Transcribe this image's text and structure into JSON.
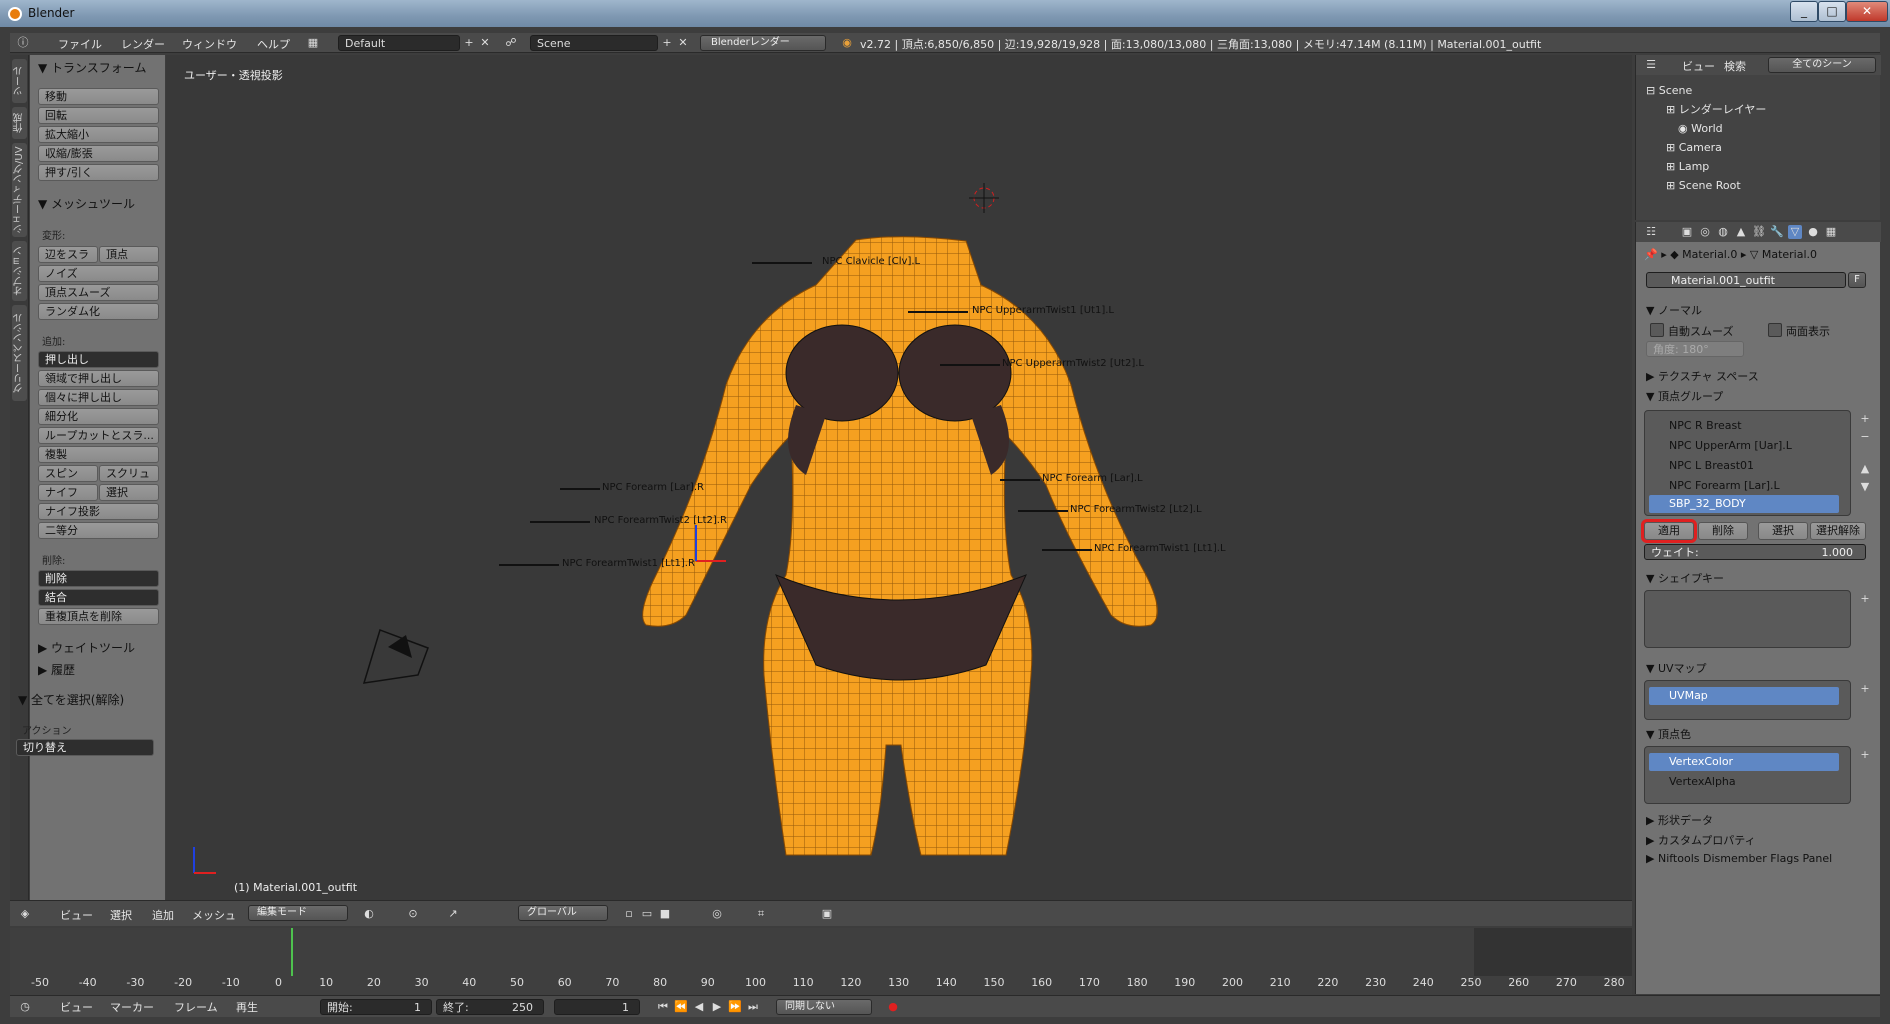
{
  "window": {
    "title": "Blender",
    "buttons": [
      "_",
      "□",
      "✕"
    ]
  },
  "info_header": {
    "menus": [
      "ファイル",
      "レンダー",
      "ウィンドウ",
      "ヘルプ"
    ],
    "screen_layout": "Default",
    "scene": "Scene",
    "render_engine": "Blenderレンダー",
    "stats": "v2.72 | 頂点:6,850/6,850 | 辺:19,928/19,928 | 面:13,080/13,080 | 三角面:13,080 | メモリ:47.14M (8.11M) | Material.001_outfit"
  },
  "left_tabs": [
    "ツール",
    "作成",
    "シェーディング/UV",
    "オプション",
    "グリースペンシル"
  ],
  "tool_panel": {
    "transform_title": "トランスフォーム",
    "transform_buttons": [
      "移動",
      "回転",
      "拡大縮小",
      "収縮/膨張",
      "押す/引く"
    ],
    "mesh_tools_title": "メッシュツール",
    "deform_label": "変形:",
    "deform_row1": [
      "辺をスラ",
      "頂点"
    ],
    "deform_buttons": [
      "ノイズ",
      "頂点スムーズ",
      "ランダム化"
    ],
    "add_label": "追加:",
    "extrude_select": "押し出し",
    "add_buttons": [
      "領域で押し出し",
      "個々に押し出し",
      "細分化",
      "ループカットとスラ...",
      "複製"
    ],
    "spin_row": [
      "スピン",
      "スクリュ"
    ],
    "knife_row": [
      "ナイフ",
      "選択"
    ],
    "add_buttons2": [
      "ナイフ投影",
      "二等分"
    ],
    "remove_label": "削除:",
    "remove_selects": [
      "削除",
      "結合"
    ],
    "remove_doubles": "重複頂点を削除",
    "weight_tools": "ウェイトツール",
    "history": "履歴",
    "select_all_title": "全てを選択(解除)",
    "action_label": "アクション",
    "action_value": "切り替え"
  },
  "viewport": {
    "label": "ユーザー・透視投影",
    "object_label": "(1) Material.001_outfit",
    "bone_labels": [
      "NPC Clavicle [Clv].L",
      "NPC UpperarmTwist1 [Ut1].L",
      "NPC UpperarmTwist2 [Ut2].L",
      "NPC Forearm [Lar].R",
      "NPC ForearmTwist2 [Lt2].R",
      "NPC ForearmTwist1 [Lt1].R",
      "NPC Forearm [Lar].L",
      "NPC ForearmTwist2 [Lt2].L",
      "NPC ForearmTwist1 [Lt1].L"
    ]
  },
  "view_header": {
    "menus": [
      "ビュー",
      "選択",
      "追加",
      "メッシュ"
    ],
    "mode": "編集モード",
    "orientation": "グローバル"
  },
  "timeline": {
    "ticks": [
      "-50",
      "-40",
      "-30",
      "-20",
      "-10",
      "0",
      "10",
      "20",
      "30",
      "40",
      "50",
      "60",
      "70",
      "80",
      "90",
      "100",
      "110",
      "120",
      "130",
      "140",
      "150",
      "160",
      "170",
      "180",
      "190",
      "200",
      "210",
      "220",
      "230",
      "240",
      "250",
      "260",
      "270",
      "280"
    ],
    "menus": [
      "ビュー",
      "マーカー",
      "フレーム",
      "再生"
    ],
    "start": "開始:",
    "start_value": "1",
    "end": "終了:",
    "end_value": "250",
    "current": "1",
    "sync": "同期しない"
  },
  "outliner": {
    "header_menus": [
      "ビュー",
      "検索"
    ],
    "filter": "全てのシーン",
    "rows": [
      "Scene",
      "レンダーレイヤー",
      "World",
      "Camera",
      "Lamp",
      "Scene Root"
    ]
  },
  "properties": {
    "breadcrumb": [
      "Material.0",
      "Material.0"
    ],
    "mesh_name": "Material.001_outfit",
    "fake_user": "F",
    "normals_title": "ノーマル",
    "auto_smooth": "自動スムーズ",
    "double_sided": "両面表示",
    "angle": "角度:     180°",
    "texture_space": "テクスチャ スペース",
    "vertex_groups_title": "頂点グループ",
    "vertex_groups": [
      "NPC R Breast",
      "NPC UpperArm [Uar].L",
      "NPC L Breast01",
      "NPC Forearm [Lar].L",
      "SBP_32_BODY"
    ],
    "vg_buttons": [
      "適用",
      "削除",
      "選択",
      "選択解除"
    ],
    "weight": "ウェイト:",
    "weight_value": "1.000",
    "shape_keys_title": "シェイプキー",
    "uv_maps_title": "UVマップ",
    "uv_maps": [
      "UVMap"
    ],
    "vertex_colors_title": "頂点色",
    "vertex_colors": [
      "VertexColor",
      "VertexAlpha"
    ],
    "shape_data": "形状データ",
    "custom_props": "カスタムプロパティ",
    "niftools": "Niftools Dismember Flags Panel"
  },
  "colors": {
    "mesh": "#f5a020",
    "selected": "#5f87c4",
    "highlight": "#e02020"
  }
}
